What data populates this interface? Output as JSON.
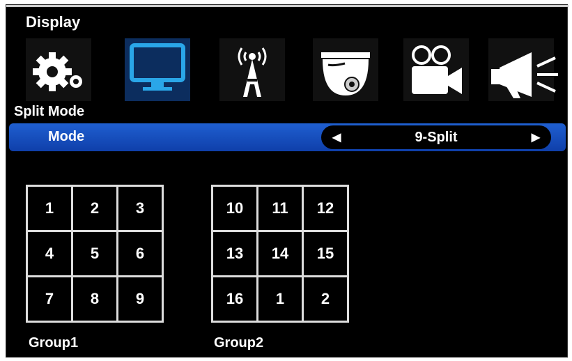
{
  "header": {
    "title": "Display"
  },
  "icons": [
    {
      "name": "gear-icon",
      "label": "System",
      "selected": false
    },
    {
      "name": "monitor-icon",
      "label": "Display",
      "selected": true
    },
    {
      "name": "antenna-icon",
      "label": "Network",
      "selected": false
    },
    {
      "name": "dome-camera-icon",
      "label": "Camera",
      "selected": false
    },
    {
      "name": "video-camera-icon",
      "label": "Record",
      "selected": false
    },
    {
      "name": "megaphone-icon",
      "label": "Alarm",
      "selected": false
    }
  ],
  "section": {
    "title": "Split Mode"
  },
  "mode_row": {
    "label": "Mode",
    "value": "9-Split",
    "left_arrow": "◀",
    "right_arrow": "▶"
  },
  "groups": [
    {
      "label": "Group1",
      "cells": [
        "1",
        "2",
        "3",
        "4",
        "5",
        "6",
        "7",
        "8",
        "9"
      ]
    },
    {
      "label": "Group2",
      "cells": [
        "10",
        "11",
        "12",
        "13",
        "14",
        "15",
        "16",
        "1",
        "2"
      ]
    }
  ],
  "colors": {
    "accent": "#1f5fd0",
    "monitor": "#2aa6e8",
    "background": "#000000"
  }
}
